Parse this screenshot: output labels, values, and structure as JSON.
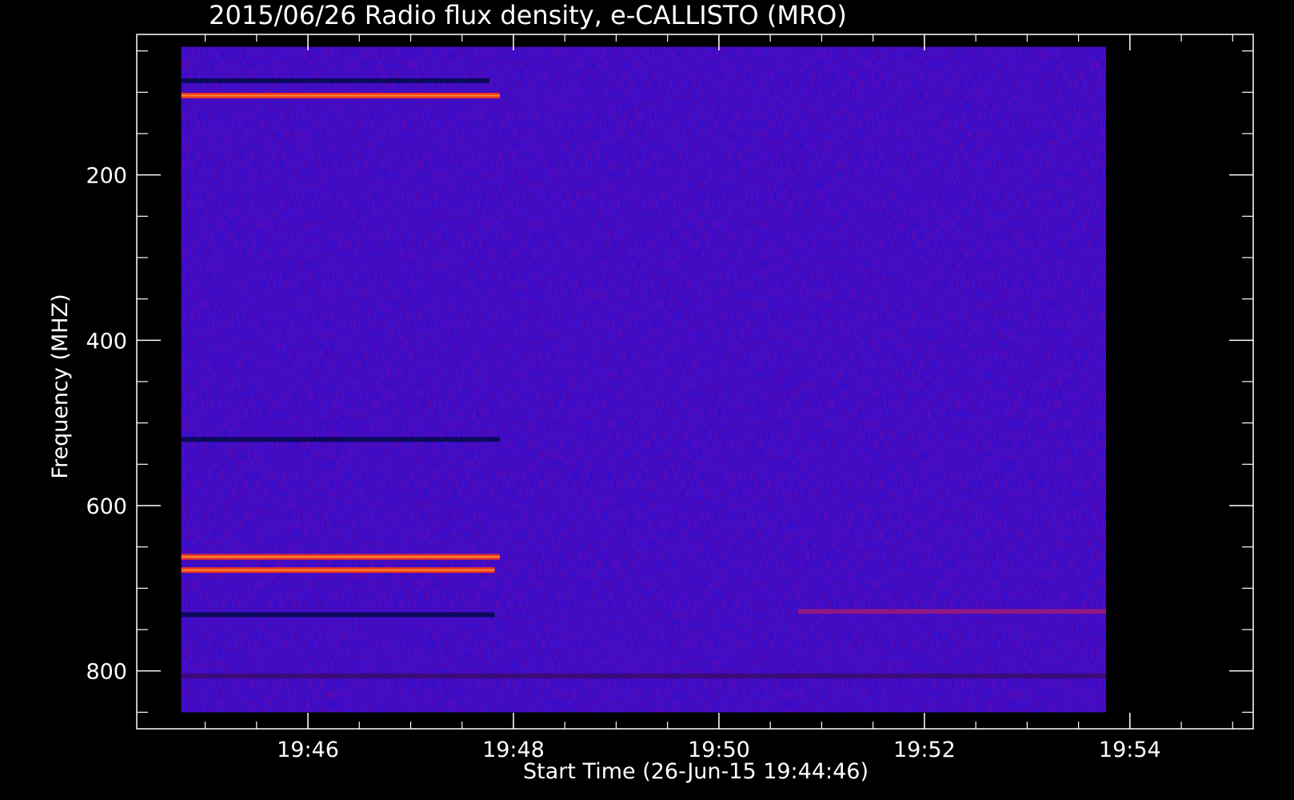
{
  "chart_data": {
    "type": "heatmap",
    "title": "2015/06/26  Radio flux density, e-CALLISTO (MRO)",
    "xlabel": "Start Time (26-Jun-15 19:44:46)",
    "ylabel": "Frequency (MHZ)",
    "x_tick_labels": [
      "19:46",
      "19:48",
      "19:50",
      "19:52",
      "19:54"
    ],
    "x_tick_values_min": [
      1.233,
      3.233,
      5.233,
      7.233,
      9.233
    ],
    "x_range_min": [
      -0.433,
      10.433
    ],
    "x_data_range_min": [
      0.0,
      9.0
    ],
    "y_tick_labels": [
      "200",
      "400",
      "600",
      "800"
    ],
    "y_tick_values": [
      200,
      400,
      600,
      800
    ],
    "y_range": [
      30,
      870
    ],
    "y_data_range": [
      45,
      850
    ],
    "y_reversed": true,
    "grid": false,
    "colormap": "blue-red-yellow (low=dark blue, high=yellow)",
    "background_color": "#1a10e0",
    "features": [
      {
        "kind": "enhanced",
        "freq": 104,
        "t0": 0.0,
        "t1": 3.1,
        "level": "high"
      },
      {
        "kind": "depressed",
        "freq": 86,
        "t0": 0.0,
        "t1": 3.0,
        "level": "low"
      },
      {
        "kind": "enhanced",
        "freq": 662,
        "t0": 0.0,
        "t1": 3.1,
        "level": "high"
      },
      {
        "kind": "enhanced",
        "freq": 678,
        "t0": 0.0,
        "t1": 3.05,
        "level": "high"
      },
      {
        "kind": "depressed",
        "freq": 732,
        "t0": 0.0,
        "t1": 3.05,
        "level": "low"
      },
      {
        "kind": "depressed",
        "freq": 520,
        "t0": 0.0,
        "t1": 3.1,
        "level": "low"
      },
      {
        "kind": "enhanced",
        "freq": 728,
        "t0": 6.0,
        "t1": 9.0,
        "level": "medium"
      },
      {
        "kind": "mixed",
        "freq": 806,
        "t0": 0.0,
        "t1": 9.0,
        "level": "medium"
      }
    ]
  }
}
